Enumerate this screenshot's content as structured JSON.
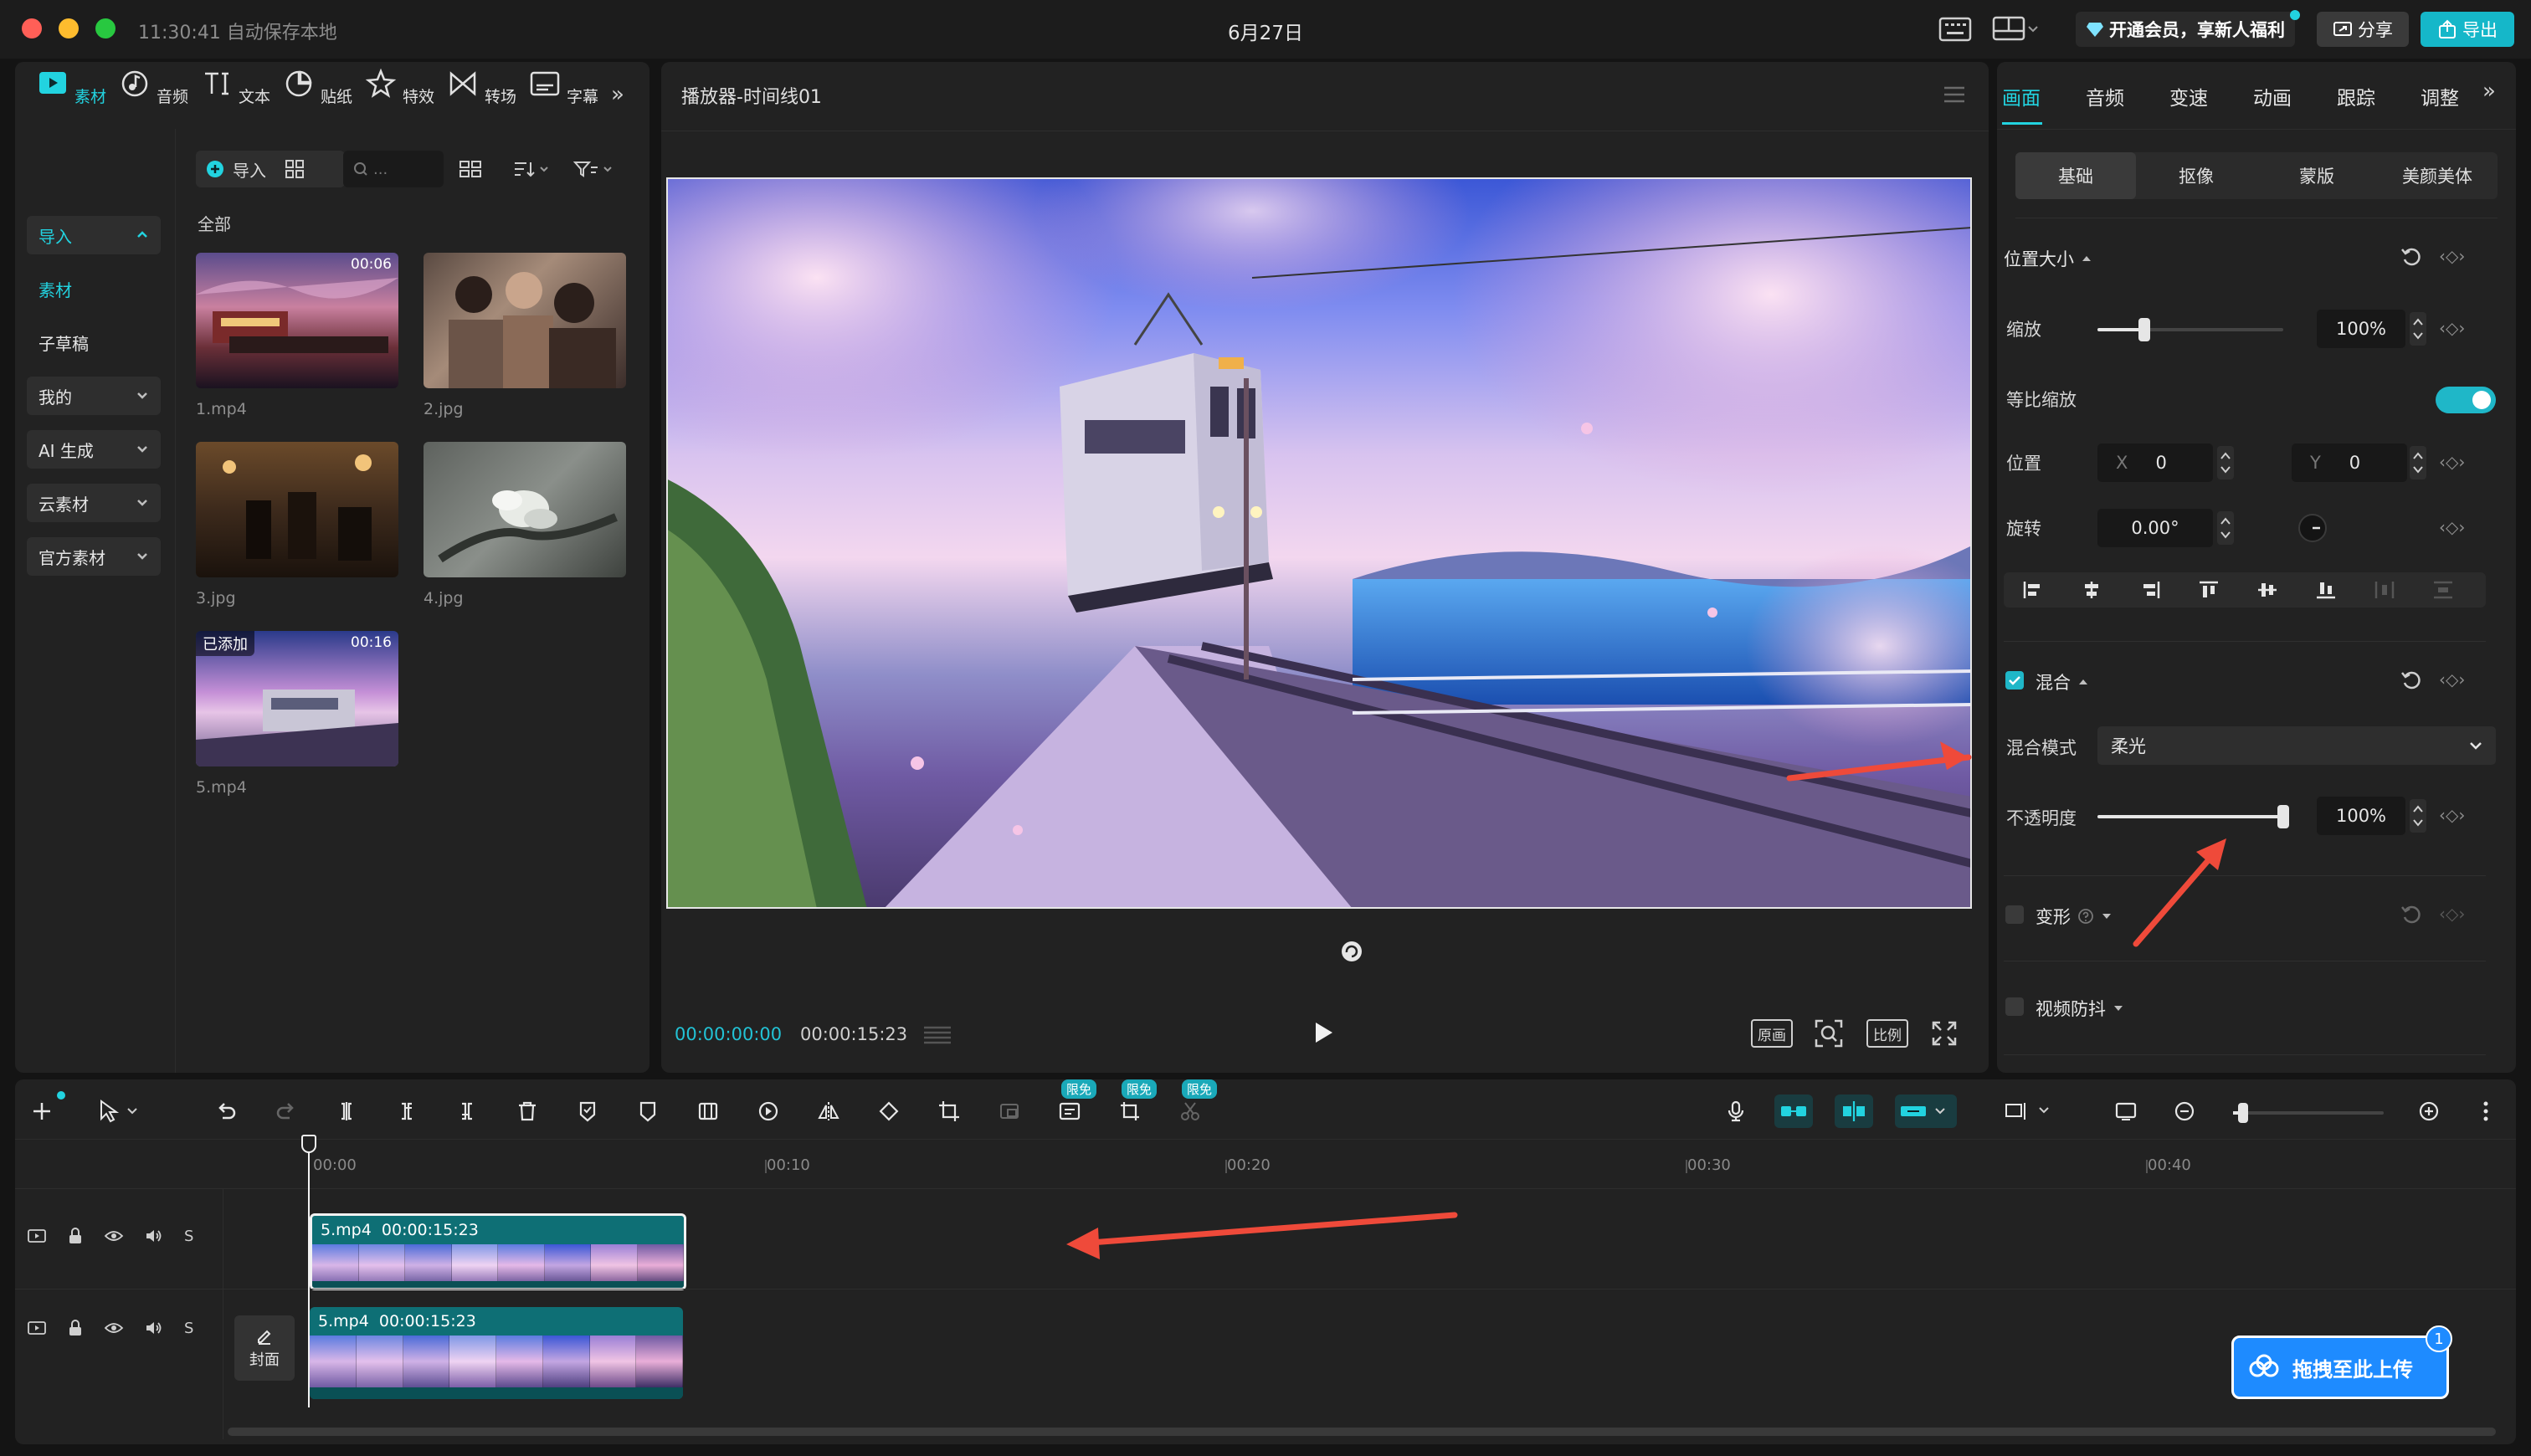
{
  "titlebar": {
    "autosave": "11:30:41 自动保存本地",
    "title": "6月27日",
    "vip_promo": "开通会员，享新人福利",
    "share_label": "分享",
    "export_label": "导出"
  },
  "left_panel": {
    "tabs": [
      {
        "label": "素材",
        "icon": "media-icon"
      },
      {
        "label": "音频",
        "icon": "audio-icon"
      },
      {
        "label": "文本",
        "icon": "text-icon"
      },
      {
        "label": "贴纸",
        "icon": "sticker-icon"
      },
      {
        "label": "特效",
        "icon": "effects-icon"
      },
      {
        "label": "转场",
        "icon": "transition-icon"
      },
      {
        "label": "字幕",
        "icon": "subtitle-icon"
      }
    ],
    "sidebar": [
      {
        "label": "导入"
      },
      {
        "label": "素材"
      },
      {
        "label": "子草稿"
      },
      {
        "label": "我的"
      },
      {
        "label": "AI 生成"
      },
      {
        "label": "云素材"
      },
      {
        "label": "官方素材"
      }
    ],
    "import_button": "导入",
    "search_placeholder": "...",
    "section_title": "全部",
    "media": [
      {
        "name": "1.mp4",
        "duration": "00:06",
        "added": ""
      },
      {
        "name": "2.jpg",
        "duration": "",
        "added": ""
      },
      {
        "name": "3.jpg",
        "duration": "",
        "added": ""
      },
      {
        "name": "4.jpg",
        "duration": "",
        "added": ""
      },
      {
        "name": "5.mp4",
        "duration": "00:16",
        "added": "已添加"
      }
    ]
  },
  "player": {
    "title": "播放器-时间线01",
    "current_time": "00:00:00:00",
    "total_time": "00:00:15:23",
    "btn_original": "原画",
    "btn_ratio": "比例"
  },
  "inspector": {
    "tabs": [
      "画面",
      "音频",
      "变速",
      "动画",
      "跟踪",
      "调整"
    ],
    "subtabs": [
      "基础",
      "抠像",
      "蒙版",
      "美颜美体"
    ],
    "position_size": "位置大小",
    "scale_label": "缩放",
    "scale_value": "100%",
    "scale_fraction": 0.25,
    "uniform_scale_label": "等比缩放",
    "position_label": "位置",
    "x_label": "X",
    "x_value": "0",
    "y_label": "Y",
    "y_value": "0",
    "rotate_label": "旋转",
    "rotate_value": "0.00°",
    "blend_title": "混合",
    "blend_mode_label": "混合模式",
    "blend_mode_value": "柔光",
    "opacity_label": "不透明度",
    "opacity_value": "100%",
    "opacity_fraction": 1.0,
    "transform_title": "变形",
    "stabilize_title": "视频防抖"
  },
  "timeline": {
    "badge_label": "限免",
    "ticks": [
      "00:00",
      "00:10",
      "00:20",
      "00:30",
      "00:40"
    ],
    "tracks": [
      {
        "clip_name": "5.mp4",
        "clip_duration": "00:00:15:23"
      },
      {
        "clip_name": "5.mp4",
        "clip_duration": "00:00:15:23"
      }
    ],
    "track_s_label": "S",
    "cover_label": "封面"
  },
  "upload": {
    "label": "拖拽至此上传",
    "count": "1"
  },
  "colors": {
    "accent": "#22d3e0",
    "arrow": "#ef4a3a",
    "clip": "#0e6f75"
  }
}
